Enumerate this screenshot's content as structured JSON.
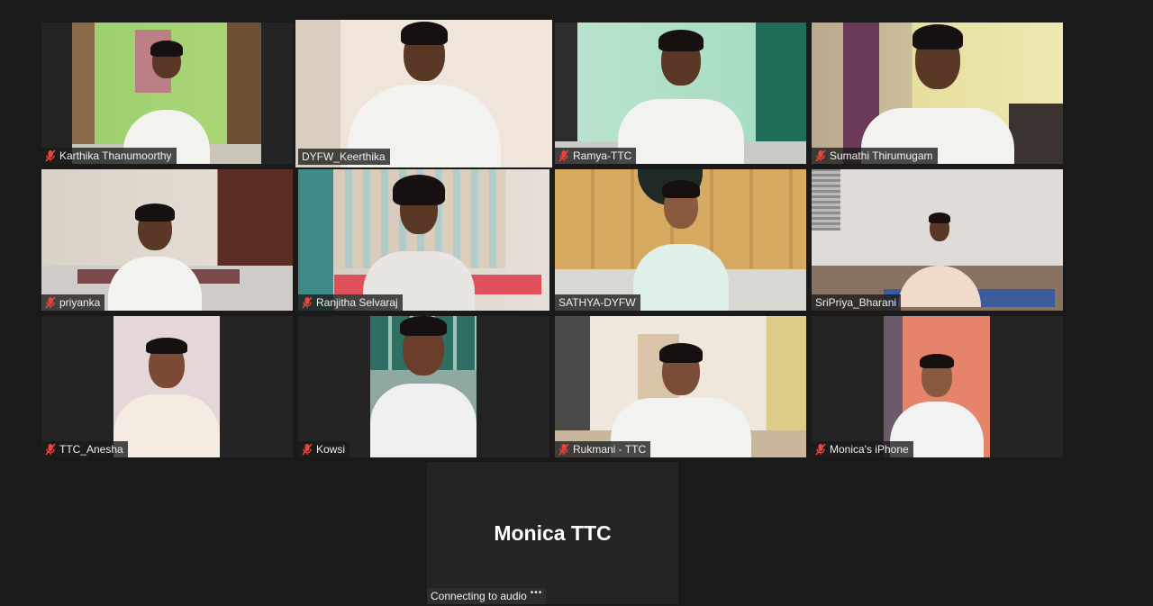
{
  "participants": [
    {
      "name": "Karthika Thanumoorthy",
      "muted": true
    },
    {
      "name": "DYFW_Keerthika",
      "muted": false,
      "active_speaker": true
    },
    {
      "name": "Ramya-TTC",
      "muted": true
    },
    {
      "name": "Sumathi Thirumugam",
      "muted": true
    },
    {
      "name": "priyanka",
      "muted": true
    },
    {
      "name": "Ranjitha Selvaraj",
      "muted": true
    },
    {
      "name": "SATHYA-DYFW",
      "muted": false
    },
    {
      "name": "SriPriya_Bharani",
      "muted": false
    },
    {
      "name": "TTC_Anesha",
      "muted": true
    },
    {
      "name": "Kowsi",
      "muted": true
    },
    {
      "name": "Rukmani - TTC",
      "muted": true
    },
    {
      "name": "Monica's iPhone",
      "muted": true
    }
  ],
  "no_video_participant": {
    "display_name": "Monica TTC",
    "status": "Connecting to audio"
  },
  "colors": {
    "background": "#1a1a1a",
    "tile": "#242424",
    "active_border": "#d7e06a",
    "muted_icon": "#e8453c"
  },
  "icons": {
    "muted": "mic-muted-icon",
    "connecting": "more-dots-icon"
  }
}
